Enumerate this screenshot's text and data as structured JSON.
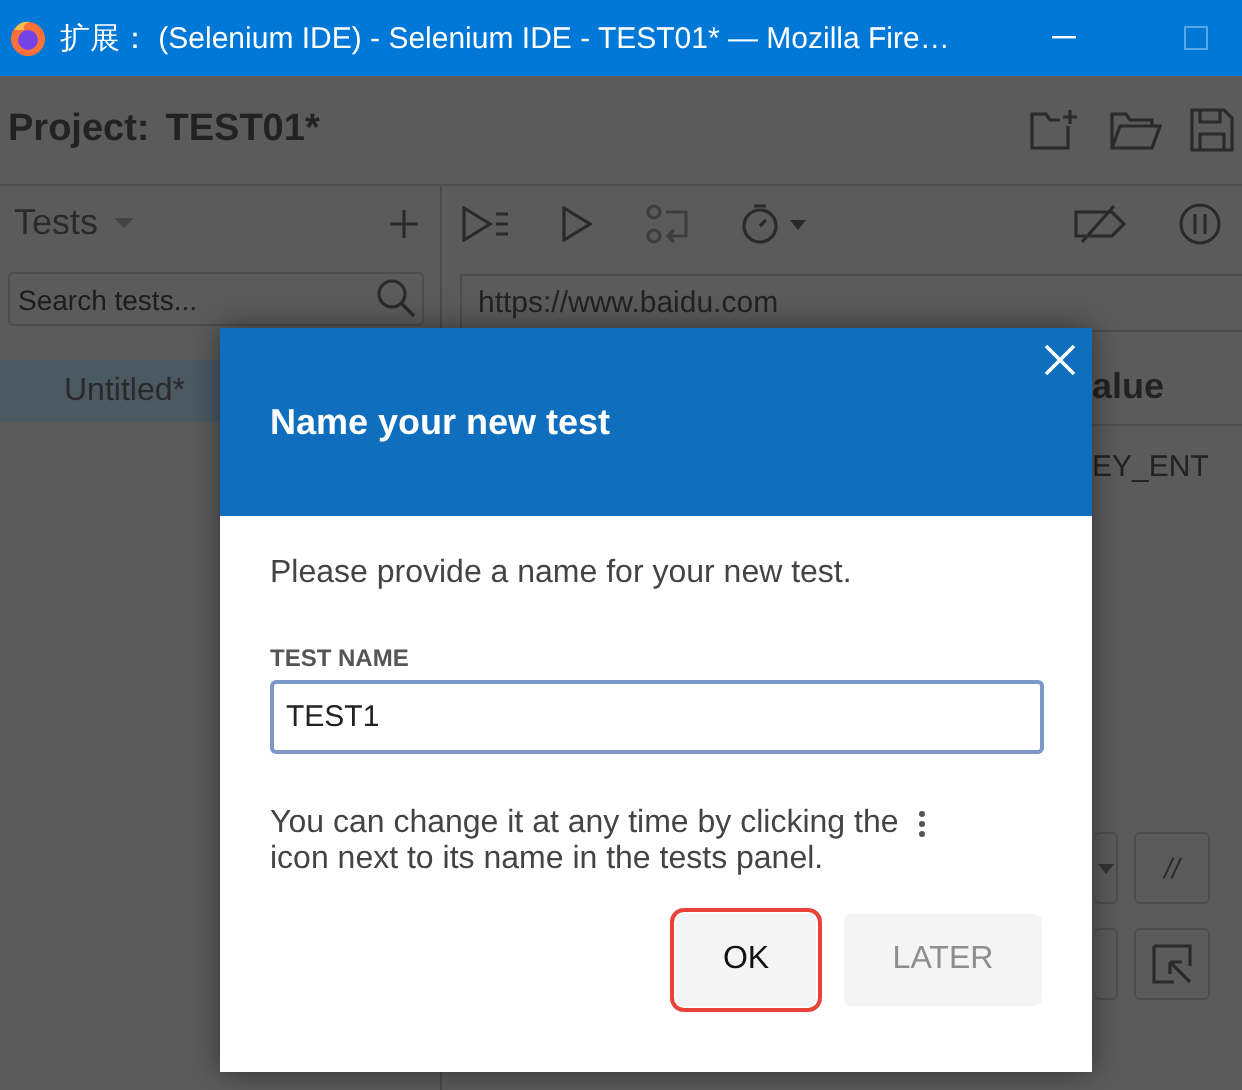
{
  "window": {
    "title": "扩展： (Selenium IDE) - Selenium IDE - TEST01* — Mozilla Fire…"
  },
  "project": {
    "label": "Project:",
    "name": "TEST01*"
  },
  "tests_panel": {
    "title": "Tests",
    "search": {
      "placeholder": "Search tests..."
    },
    "items": [
      {
        "label": "Untitled*",
        "selected": true
      }
    ]
  },
  "editor": {
    "url": "https://www.baidu.com",
    "table": {
      "columns": [
        "alue"
      ],
      "rows": [
        [
          "EY_ENT"
        ]
      ]
    },
    "buttons": [
      {
        "label": "//"
      }
    ]
  },
  "dialog": {
    "title": "Name your new test",
    "prompt": "Please provide a name for your new test.",
    "field": {
      "label": "TEST NAME",
      "value": "TEST1"
    },
    "hint_lines": [
      "You can change it at any time by clicking the",
      "icon next to its name in the tests panel."
    ],
    "buttons": [
      {
        "label": "OK",
        "disabled": false,
        "highlighted": true
      },
      {
        "label": "LATER",
        "disabled": true,
        "highlighted": false
      }
    ]
  }
}
